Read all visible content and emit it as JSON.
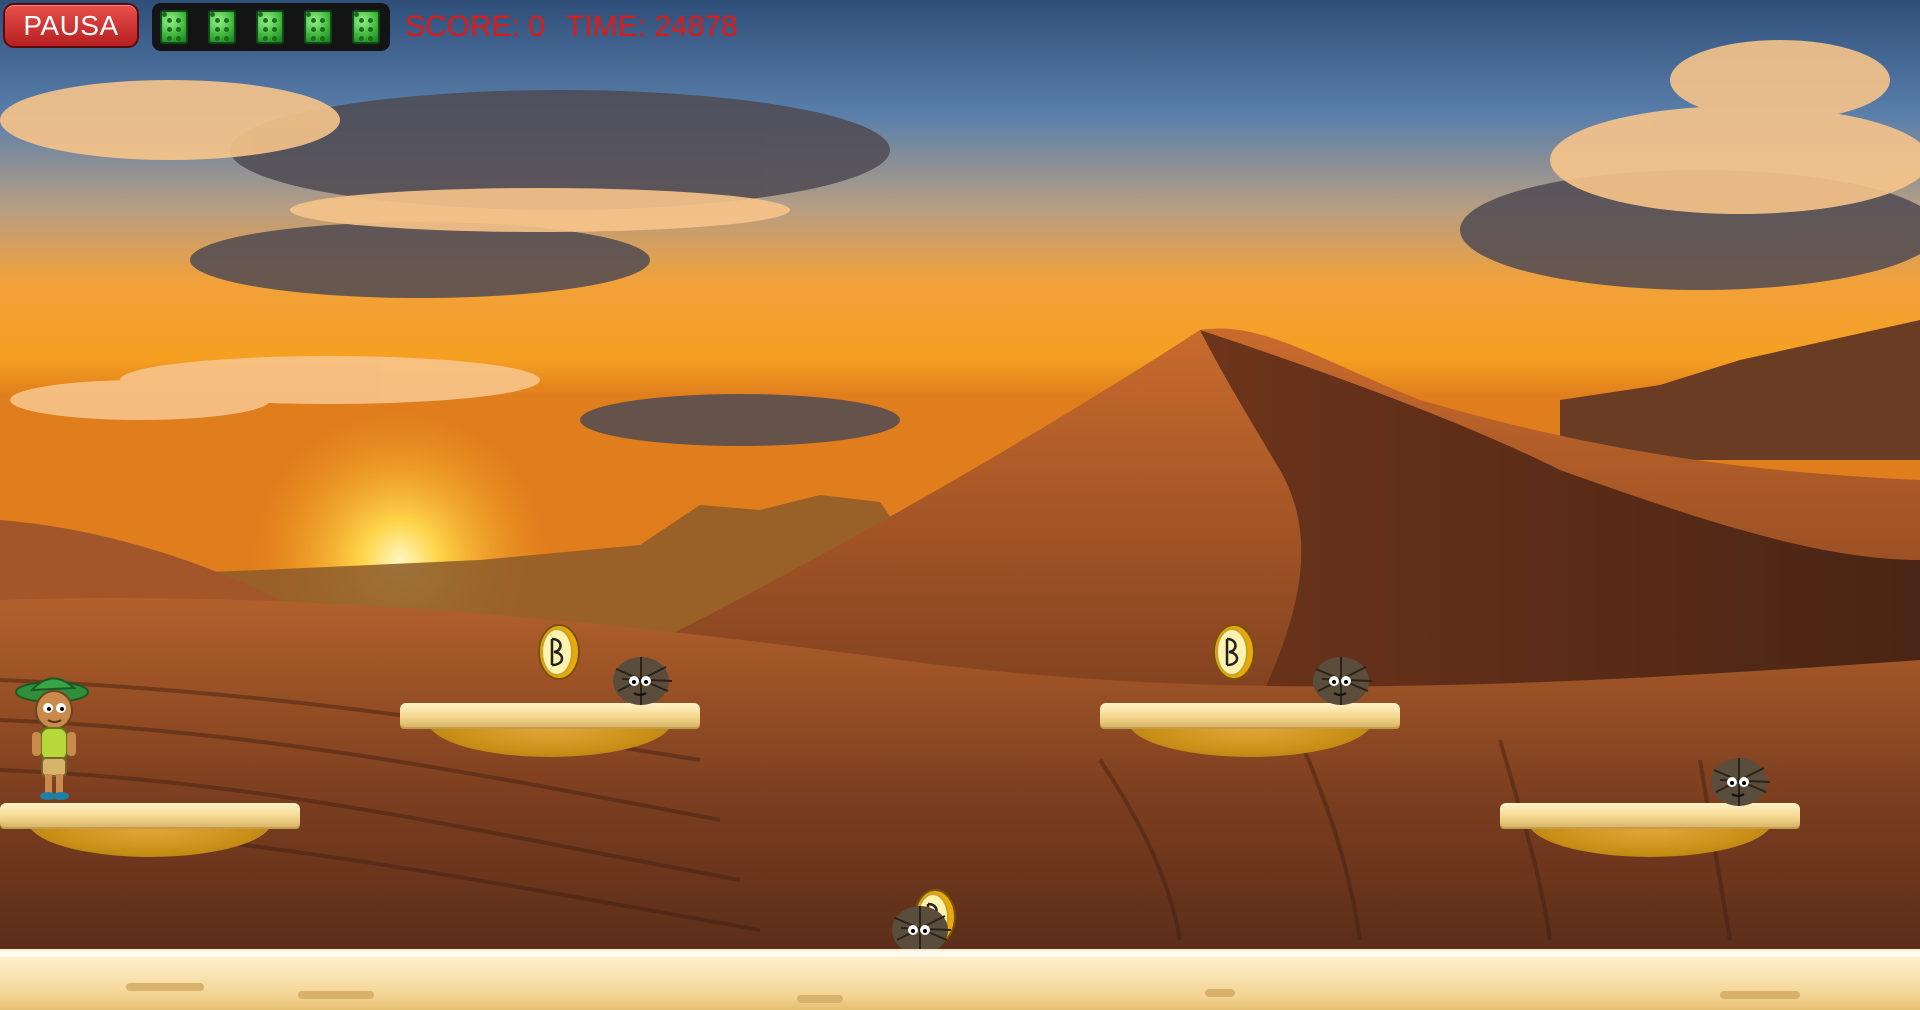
{
  "hud": {
    "pause_label": "PAUSA",
    "lives_count": 5,
    "score_text": "SCORE: 0",
    "time_text": "TIME: 24878"
  },
  "colors": {
    "pause_button": "#c8302a",
    "hud_text": "#e01a14",
    "life_block": "#3fb83d",
    "platform_top": "#f3d68c",
    "platform_base": "#c88f17"
  },
  "icons": {
    "life": "green-block-icon",
    "coin": "gold-coin-icon",
    "enemy": "tumbleweed-enemy-icon",
    "player": "explorer-boy-icon"
  }
}
